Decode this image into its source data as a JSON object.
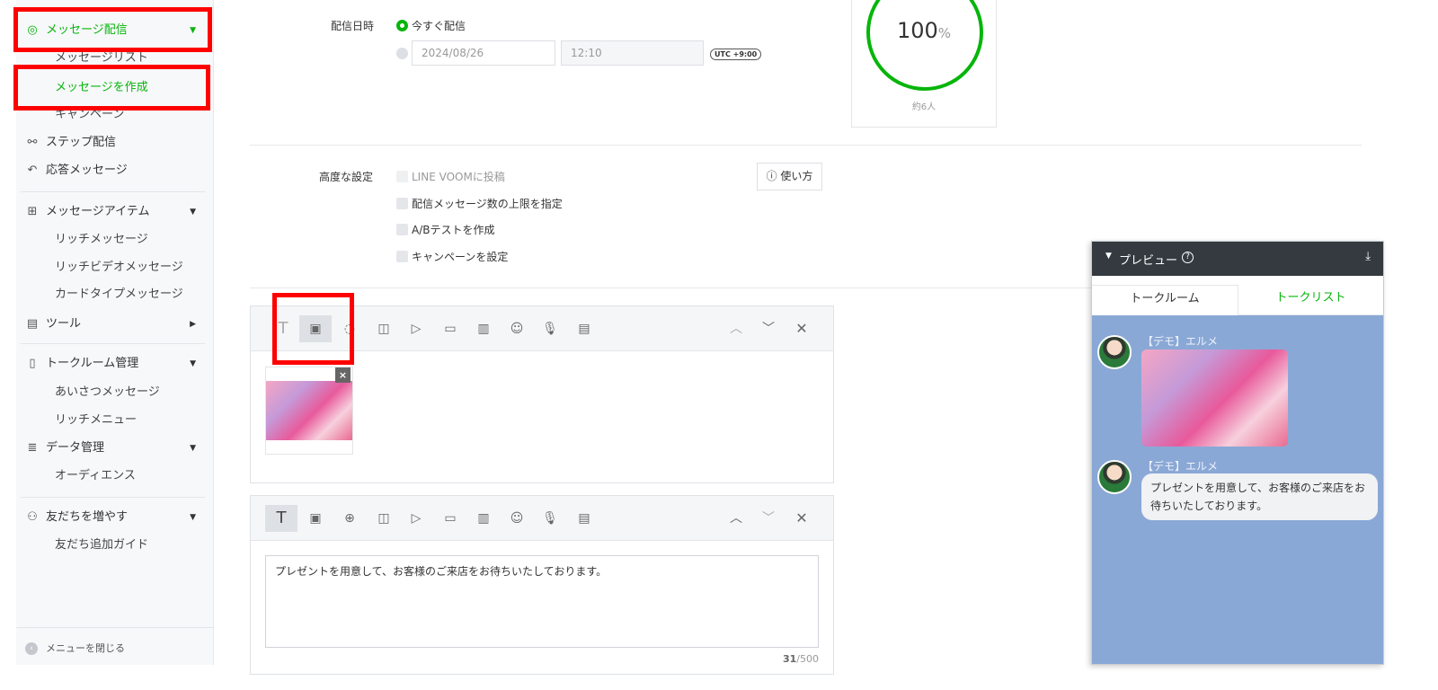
{
  "sidebar": {
    "items": [
      {
        "label": "メッセージ配信",
        "icon": "broadcast-icon",
        "active": true,
        "expanded": true
      },
      {
        "label": "メッセージリスト"
      },
      {
        "label": "メッセージを作成",
        "active": true
      },
      {
        "label": "キャンペーン"
      },
      {
        "label": "ステップ配信",
        "icon": "hierarchy-icon"
      },
      {
        "label": "応答メッセージ",
        "icon": "reply-icon"
      },
      {
        "label": "メッセージアイテム",
        "icon": "message-plus-icon"
      },
      {
        "label": "リッチメッセージ"
      },
      {
        "label": "リッチビデオメッセージ"
      },
      {
        "label": "カードタイプメッセージ"
      },
      {
        "label": "ツール",
        "icon": "shop-icon"
      },
      {
        "label": "トークルーム管理",
        "icon": "talkroom-icon"
      },
      {
        "label": "あいさつメッセージ"
      },
      {
        "label": "リッチメニュー"
      },
      {
        "label": "データ管理",
        "icon": "database-icon"
      },
      {
        "label": "オーディエンス"
      },
      {
        "label": "友だちを増やす",
        "icon": "add-friend-icon"
      },
      {
        "label": "友だち追加ガイド"
      }
    ],
    "close_menu": "メニューを閉じる"
  },
  "schedule": {
    "label": "配信日時",
    "now_option": "今すぐ配信",
    "date": "2024/08/26",
    "time": "12:10",
    "timezone": "UTC +9:00"
  },
  "reach": {
    "value": "100",
    "unit": "%",
    "percent": 100,
    "people": "約6人"
  },
  "advanced": {
    "label": "高度な設定",
    "help_button": "使い方",
    "options": [
      "LINE VOOMに投稿",
      "配信メッセージ数の上限を指定",
      "A/Bテストを作成",
      "キャンペーンを設定"
    ]
  },
  "editor1": {
    "active_tool": "image"
  },
  "editor2": {
    "active_tool": "text",
    "text": "プレゼントを用意して、お客様のご来店をお待ちいたしております。",
    "counter_current": "31",
    "counter_max": "/500"
  },
  "toolbar_icons": [
    "T",
    "image-icon",
    "bubble-icon",
    "card-icon",
    "video-icon",
    "coupon-icon",
    "richvideo-icon",
    "emoji-icon",
    "mic-icon",
    "clipboard-icon"
  ],
  "preview": {
    "title": "プレビュー",
    "tabs": [
      "トークルーム",
      "トークリスト"
    ],
    "sender": "【デモ】エルメ",
    "message": "プレゼントを用意して、お客様のご来店をお待ちいたしております。"
  },
  "colors": {
    "accent": "#06b50a",
    "highlight": "#ff0000",
    "preview_header": "#343a40",
    "chat_bg": "#8aa8d6"
  }
}
